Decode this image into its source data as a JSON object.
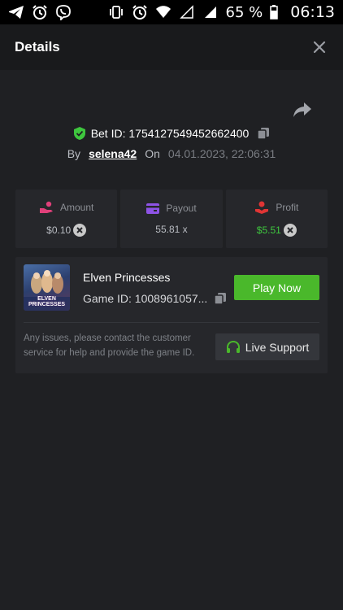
{
  "status_bar": {
    "battery_percent": "65 %",
    "time": "06:13",
    "left_icons": [
      "telegram-icon",
      "alarm-icon",
      "viber-icon"
    ],
    "right_icons": [
      "vibrate-icon",
      "alarm-icon",
      "wifi-icon",
      "signal-empty-icon",
      "signal-full-icon",
      "battery-icon"
    ]
  },
  "header": {
    "title": "Details"
  },
  "bet": {
    "id_label": "Bet ID: 1754127549452662400",
    "by_label": "By",
    "username": "selena42",
    "on_label": "On",
    "date": "04.01.2023, 22:06:31"
  },
  "stats": [
    {
      "label": "Amount",
      "value": "$0.10",
      "icon": "hand-coins-icon"
    },
    {
      "label": "Payout",
      "value": "55.81 x",
      "icon": "card-icon"
    },
    {
      "label": "Profit",
      "value": "$5.51",
      "icon": "profit-icon"
    }
  ],
  "game": {
    "name": "Elven Princesses",
    "thumbnail_text": "ELVEN PRINCESSES",
    "game_id": "Game ID: 1008961057...",
    "play_label": "Play Now",
    "support_text": "Any issues, please contact the customer service for help and provide the game ID.",
    "support_label": "Live Support"
  },
  "colors": {
    "background": "#1f2023",
    "header": "#191a1c",
    "card": "#26272b",
    "accent_green": "#4ab82b",
    "profit_green": "#3ec63e",
    "amount_pink": "#e0407a",
    "payout_purple": "#8e53e6",
    "profit_red": "#e03535"
  }
}
